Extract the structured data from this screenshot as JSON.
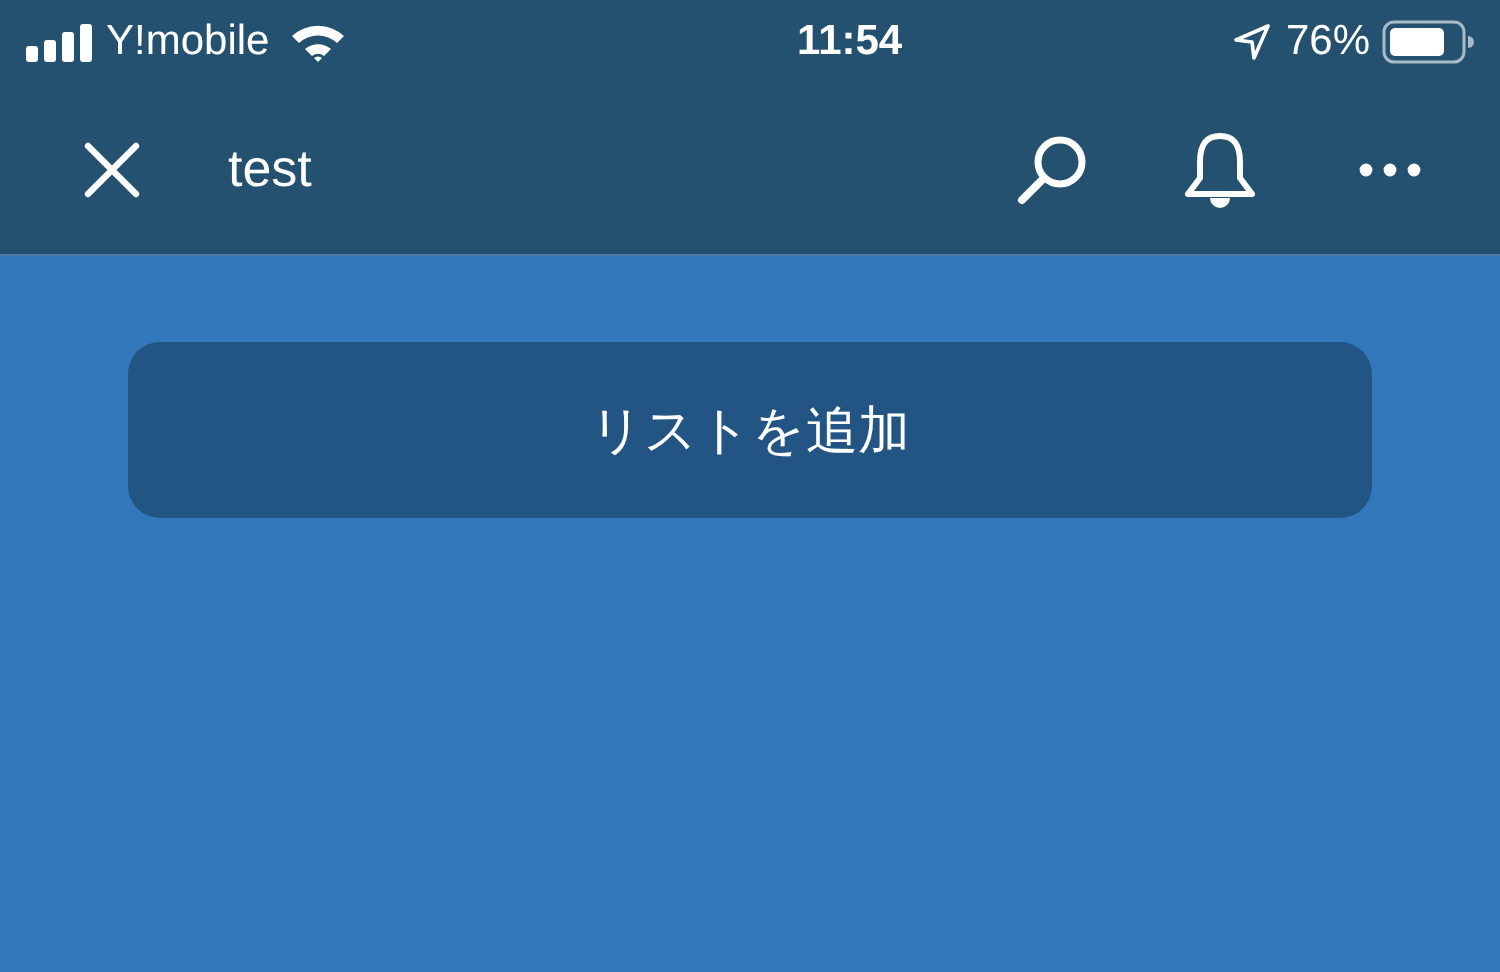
{
  "status_bar": {
    "carrier": "Y!mobile",
    "time": "11:54",
    "battery": "76%"
  },
  "header": {
    "title": "test"
  },
  "add_list_button": {
    "label": "リストを追加"
  }
}
